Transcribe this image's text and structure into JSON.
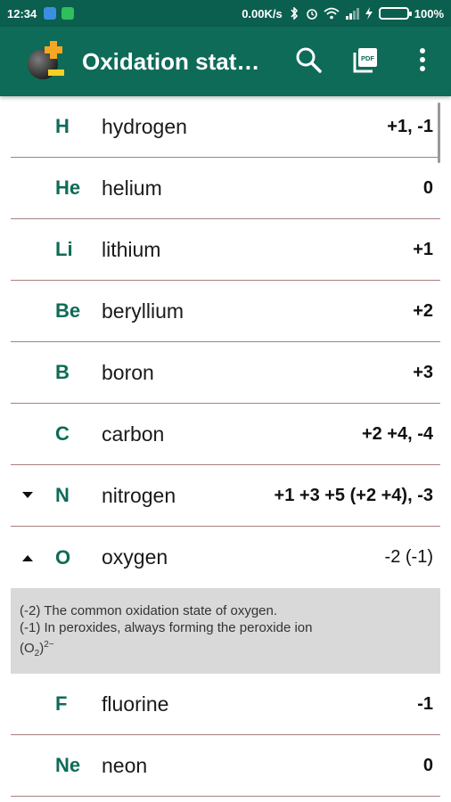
{
  "status_bar": {
    "time": "12:34",
    "network_speed": "0.00K/s",
    "battery": "100%"
  },
  "app_bar": {
    "title": "Oxidation stat…",
    "actions": [
      "search-icon",
      "pdf-icon",
      "more-vert-icon"
    ],
    "pdf_label": "PDF",
    "accent_color": "#0e6b57"
  },
  "elements": [
    {
      "symbol": "H",
      "name": "hydrogen",
      "states": "+1,  -1",
      "arrow": ""
    },
    {
      "symbol": "He",
      "name": "helium",
      "states": "0",
      "arrow": ""
    },
    {
      "symbol": "Li",
      "name": "lithium",
      "states": "+1",
      "arrow": ""
    },
    {
      "symbol": "Be",
      "name": "beryllium",
      "states": "+2",
      "arrow": ""
    },
    {
      "symbol": "B",
      "name": "boron",
      "states": "+3",
      "arrow": ""
    },
    {
      "symbol": "C",
      "name": "carbon",
      "states": "+2 +4,  -4",
      "arrow": ""
    },
    {
      "symbol": "N",
      "name": "nitrogen",
      "states": "+1 +3 +5 (+2 +4),  -3",
      "arrow": "down"
    },
    {
      "symbol": "O",
      "name": "oxygen",
      "states": "-2 (-1)",
      "arrow": "up"
    }
  ],
  "oxygen_note": {
    "line1": "(-2) The common oxidation state of oxygen.",
    "line2": "(-1) In peroxides, always forming the peroxide ion",
    "line3_pre": "(O",
    "line3_sub": "2",
    "line3_post": ")",
    "line3_sup": "2−"
  },
  "elements_after": [
    {
      "symbol": "F",
      "name": "fluorine",
      "states": "-1"
    },
    {
      "symbol": "Ne",
      "name": "neon",
      "states": "0"
    }
  ]
}
